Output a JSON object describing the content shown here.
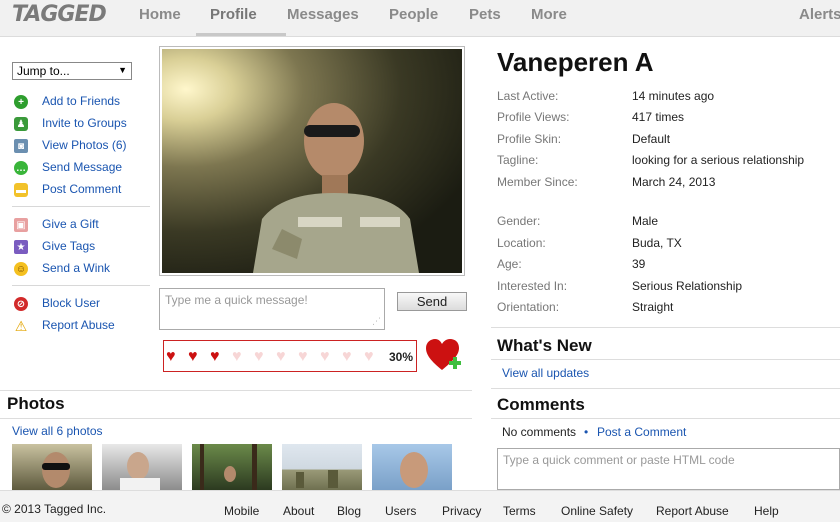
{
  "nav": {
    "logo": "TAGGED",
    "items": [
      "Home",
      "Profile",
      "Messages",
      "People",
      "Pets",
      "More"
    ],
    "alerts": "Alerts"
  },
  "sidebar": {
    "jump_label": "Jump to...",
    "actions": [
      {
        "label": "Add to Friends",
        "icon": "add-friend-icon"
      },
      {
        "label": "Invite to Groups",
        "icon": "groups-icon"
      },
      {
        "label": "View Photos (6)",
        "icon": "camera-icon"
      },
      {
        "label": "Send Message",
        "icon": "message-icon"
      },
      {
        "label": "Post Comment",
        "icon": "comment-icon"
      },
      {
        "label": "Give a Gift",
        "icon": "gift-icon"
      },
      {
        "label": "Give Tags",
        "icon": "star-icon"
      },
      {
        "label": "Send a Wink",
        "icon": "wink-icon"
      },
      {
        "label": "Block User",
        "icon": "block-icon"
      },
      {
        "label": "Report Abuse",
        "icon": "warning-icon"
      }
    ]
  },
  "quick_message": {
    "placeholder": "Type me a quick message!",
    "send_label": "Send"
  },
  "meter": {
    "filled": 3,
    "total": 10,
    "percent": "30%"
  },
  "profile": {
    "name": "Vaneperen A",
    "fields": [
      {
        "label": "Last Active:",
        "value": "14 minutes ago"
      },
      {
        "label": "Profile Views:",
        "value": "417 times"
      },
      {
        "label": "Profile Skin:",
        "value": "Default"
      },
      {
        "label": "Tagline:",
        "value": "looking for a serious relationship"
      },
      {
        "label": "Member Since:",
        "value": "March 24, 2013"
      },
      {
        "label": "Gender:",
        "value": "Male"
      },
      {
        "label": "Location:",
        "value": "Buda, TX"
      },
      {
        "label": "Age:",
        "value": "39"
      },
      {
        "label": "Interested In:",
        "value": "Serious Relationship"
      },
      {
        "label": "Orientation:",
        "value": "Straight"
      }
    ]
  },
  "photos": {
    "title": "Photos",
    "view_all": "View all 6 photos"
  },
  "whats_new": {
    "title": "What's New",
    "view_all": "View all updates"
  },
  "comments": {
    "title": "Comments",
    "none": "No comments",
    "separator": "•",
    "post_link": "Post a Comment",
    "placeholder": "Type a quick comment or paste HTML code"
  },
  "footer": {
    "copyright": "© 2013 Tagged Inc.",
    "links": [
      "Mobile",
      "About",
      "Blog",
      "Users",
      "Privacy",
      "Terms",
      "Online Safety",
      "Report Abuse",
      "Help"
    ]
  },
  "colors": {
    "link": "#1a55b0",
    "heart_red": "#cc1111",
    "heart_empty": "#f7d6d6"
  }
}
